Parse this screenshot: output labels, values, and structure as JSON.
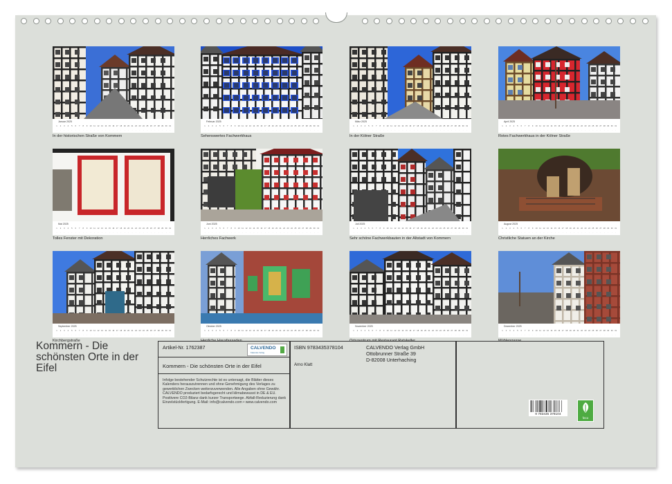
{
  "calendar": {
    "tiles": [
      {
        "month": "Januar 2025",
        "caption": "In der historischen Straße von Kommern"
      },
      {
        "month": "Februar 2025",
        "caption": "Sehenswertes Fachwerkhaus"
      },
      {
        "month": "März 2025",
        "caption": "In der Kölner Straße"
      },
      {
        "month": "April 2025",
        "caption": "Rotes Fachwerkhaus in der Kölner Straße"
      },
      {
        "month": "Mai 2025",
        "caption": "Tolles Fenster mit Dekoration"
      },
      {
        "month": "Juni 2025",
        "caption": "Herrliches Fachwerk"
      },
      {
        "month": "Juli 2025",
        "caption": "Sehr schöne Fachwerkbauten in der Altstadt von Kommern"
      },
      {
        "month": "August 2025",
        "caption": "Christliche Statuen an der Kirche"
      },
      {
        "month": "September 2025",
        "caption": "Kirchbergstraße"
      },
      {
        "month": "Oktober 2025",
        "caption": "Herrliche Hausfassaden"
      },
      {
        "month": "November 2025",
        "caption": "Ortszentrum mit Restaurant Ratskeller"
      },
      {
        "month": "Dezember 2025",
        "caption": "Mühlengasse"
      }
    ]
  },
  "title": "Kommern - Die schönsten Orte in der Eifel",
  "info": {
    "article_no": "Artikel-Nr. 1762387",
    "logo_text": "CALVENDO",
    "logo_sub": "Kalender-Verlag",
    "subtitle": "Kommern - Die schönsten Orte in der Eifel",
    "legal": "Infolge bestehender Schutzrechte ist es untersagt, die Blätter dieses Kalenders herauszutrennen und ohne Genehmigung des Verlages zu gewerblichen Zwecken weiterzuverwenden. Alle Angaben ohne Gewähr. CALVENDO produziert bedarfsgerecht und klimabewusst in DE & EU. Positivere CO2-Bilanz dank kurzer Transportwege. Abfall-Reduzierung dank Einzelstückfertigung. E-Mail: info@calvendo.com • www.calvendo.com",
    "isbn": "ISBN 9783435378104",
    "author": "Arno Klatt",
    "publisher_line1": "CALVENDO Verlag GmbH",
    "publisher_line2": "Ottobrunner Straße 39",
    "publisher_line3": "D-82008 Unterhaching",
    "barcode_number": "9 783435 378104",
    "eco_label": "feco"
  }
}
